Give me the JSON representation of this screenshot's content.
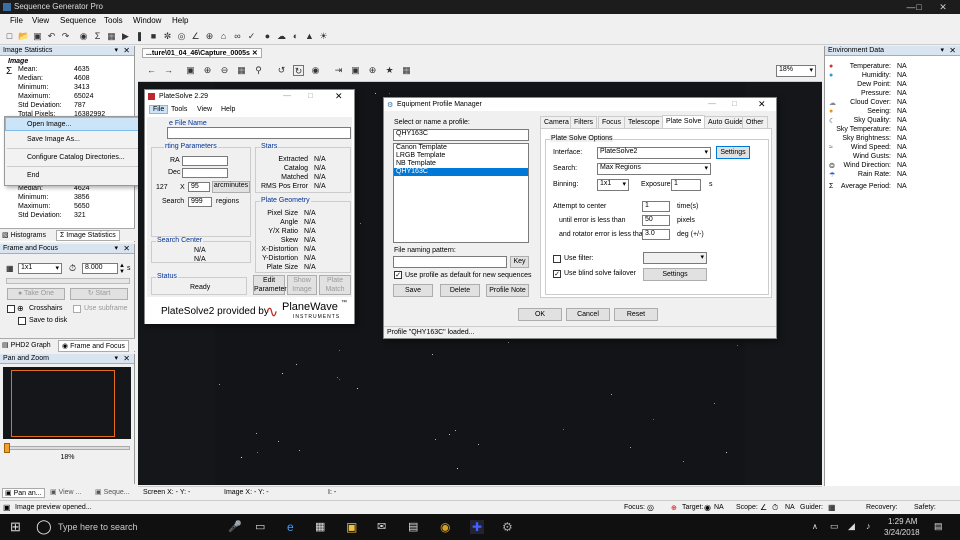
{
  "app": {
    "title": "Sequence Generator Pro"
  },
  "menubar": [
    "File",
    "View",
    "Sequence",
    "Tools",
    "Window",
    "Help"
  ],
  "doc_tab": {
    "title": "...ture\\01_04_46\\Capture_0005s"
  },
  "zoom": {
    "value": "18%"
  },
  "image_stats": {
    "header": "Image Statistics",
    "group1_title": "Image",
    "labels1": [
      "Mean:",
      "Median:",
      "Minimum:",
      "Maximum:",
      "Std Deviation:",
      "Total Pixels:"
    ],
    "values1": [
      "4635",
      "4608",
      "3413",
      "65024",
      "787",
      "16382992"
    ],
    "labels2": [
      "Median:",
      "Minimum:",
      "Maximum:",
      "Std Deviation:"
    ],
    "values2": [
      "4624",
      "3856",
      "5650",
      "321"
    ],
    "tabs": [
      "Histograms",
      "Image Statistics"
    ]
  },
  "file_menu": [
    "Open Image...",
    "Save Image As...",
    "Configure Catalog Directories...",
    "End"
  ],
  "frame_focus": {
    "header": "Frame and Focus",
    "binning": "1x1",
    "exposure": "8.000",
    "exp_unit": "s",
    "take_one": "Take One",
    "start": "Start",
    "crosshairs": "Crosshairs",
    "use_subframe": "Use subframe",
    "save_to_disk": "Save to disk",
    "tabs": [
      "PHD2 Graph",
      "Frame and Focus"
    ]
  },
  "pan_zoom": {
    "header": "Pan and Zoom",
    "zoom": "18%",
    "tabs": [
      "Pan an...",
      "View ...",
      "Seque..."
    ]
  },
  "platesolve": {
    "title": "PlateSolve 2.29",
    "menu": [
      "File",
      "Tools",
      "View",
      "Help"
    ],
    "image_file_label": "e File Name",
    "starting_params": "rting Parameters",
    "ra": "RA",
    "dec": "Dec",
    "fov_prefix": "127",
    "x": "X",
    "fov_value": "95",
    "arcminutes": "arcminutes",
    "search": "Search",
    "regions_value": "999",
    "regions": "regions",
    "search_center": "Search Center",
    "na1": "N/A",
    "na2": "N/A",
    "status": "Status",
    "ready": "Ready",
    "stars": "Stars",
    "stars_labels": [
      "Extracted",
      "Catalog",
      "Matched",
      "RMS Pos Error"
    ],
    "stars_values": [
      "N/A",
      "N/A",
      "N/A",
      "N/A"
    ],
    "plate_geometry": "Plate Geometry",
    "geo_labels": [
      "Pixel Size",
      "Angle",
      "Y/X Ratio",
      "Skew",
      "X-Distortion",
      "Y-Distortion",
      "Plate Size"
    ],
    "geo_values": [
      "N/A",
      "N/A",
      "N/A",
      "N/A",
      "N/A",
      "N/A",
      "N/A"
    ],
    "edit_params": "Edit Parameters",
    "show_image": "Show Image",
    "plate_match": "Plate Match",
    "provided_by": "PlateSolve2 provided by",
    "brand": "PlaneWave",
    "brand_sub": "INSTRUMENTS",
    "tm": "™"
  },
  "epm": {
    "title": "Equipment Profile Manager",
    "select_label": "Select or name a profile:",
    "profile_name": "QHY163C",
    "profiles": [
      "Canon Template",
      "LRGB Template",
      "NB Template",
      "QHY163C"
    ],
    "file_naming": "File naming pattern:",
    "key": "Key",
    "use_default": "Use profile as default for new sequences",
    "save": "Save",
    "delete": "Delete",
    "profile_note": "Profile Note",
    "tabs": [
      "Camera",
      "Filters",
      "Focus",
      "Telescope",
      "Plate Solve",
      "Auto Guide",
      "Other"
    ],
    "ps_options": "Plate Solve Options",
    "interface_label": "Interface:",
    "interface_value": "PlateSolve2",
    "settings": "Settings",
    "search_label": "Search:",
    "search_value": "Max Regions",
    "binning_label": "Binning:",
    "binning_value": "1x1",
    "exposure_label": "Exposure:",
    "exposure_value": "1",
    "s": "s",
    "attempt": "Attempt to center",
    "attempt_value": "1",
    "times": "time(s)",
    "until": "until error is less than",
    "until_value": "50",
    "pixels": "pixels",
    "rot": "and rotator error is less than",
    "rot_value": "3.0",
    "deg": "deg (+/-)",
    "use_filter": "Use filter:",
    "blind": "Use blind solve failover",
    "blind_settings": "Settings",
    "ok": "OK",
    "cancel": "Cancel",
    "reset": "Reset",
    "status": "Profile \"QHY163C\" loaded..."
  },
  "env": {
    "header": "Environment Data",
    "labels": [
      "Temperature:",
      "Humidity:",
      "Dew Point:",
      "Pressure:",
      "Cloud Cover:",
      "Seeing:",
      "Sky Quality:",
      "Sky Temperature:",
      "Sky Brightness:",
      "Wind Speed:",
      "Wind Gusts:",
      "Wind Direction:",
      "Rain Rate:",
      "Average Period:"
    ],
    "values": [
      "NA",
      "NA",
      "NA",
      "NA",
      "NA",
      "NA",
      "NA",
      "NA",
      "NA",
      "NA",
      "NA",
      "NA",
      "NA",
      "NA"
    ]
  },
  "statusbar": {
    "screen": "Screen X: - Y: -",
    "image": "Image X: - Y: -",
    "i": "I: -",
    "msg": "Image preview opened...",
    "focus": "Focus:",
    "target": "Target:",
    "na": "NA",
    "scope": "Scope:",
    "guider": "Guider:",
    "recovery": "Recovery:",
    "safety": "Safety:"
  },
  "taskbar": {
    "search": "Type here to search",
    "time": "1:29 AM",
    "date": "3/24/2018"
  },
  "colors": {
    "accent": "#0078d7",
    "panel_header": "#d8e4f0",
    "dark_bg": "#14161a",
    "pw_red": "#c0262d"
  }
}
